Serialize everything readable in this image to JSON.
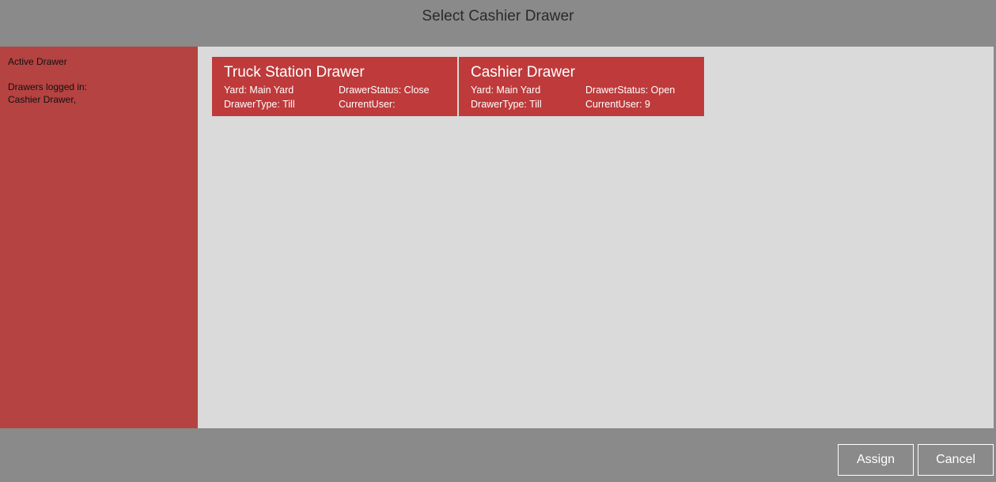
{
  "dialog": {
    "title": "Select Cashier Drawer"
  },
  "left_panel": {
    "active_drawer_label": "Active Drawer",
    "logged_in_label": "Drawers logged in:",
    "logged_in_list": "Cashier Drawer,"
  },
  "drawers": [
    {
      "name": "Truck Station Drawer",
      "yard": "Yard: Main Yard",
      "status": "DrawerStatus: Close",
      "type": "DrawerType: Till",
      "current_user": "CurrentUser:"
    },
    {
      "name": "Cashier Drawer",
      "yard": "Yard: Main Yard",
      "status": "DrawerStatus: Open",
      "type": "DrawerType: Till",
      "current_user": "CurrentUser: 9"
    }
  ],
  "buttons": {
    "assign": "Assign",
    "cancel": "Cancel"
  },
  "colors": {
    "background": "#8a8a8a",
    "left_panel": "#b54341",
    "tile": "#bf3a3b",
    "content_area": "#dadada"
  }
}
